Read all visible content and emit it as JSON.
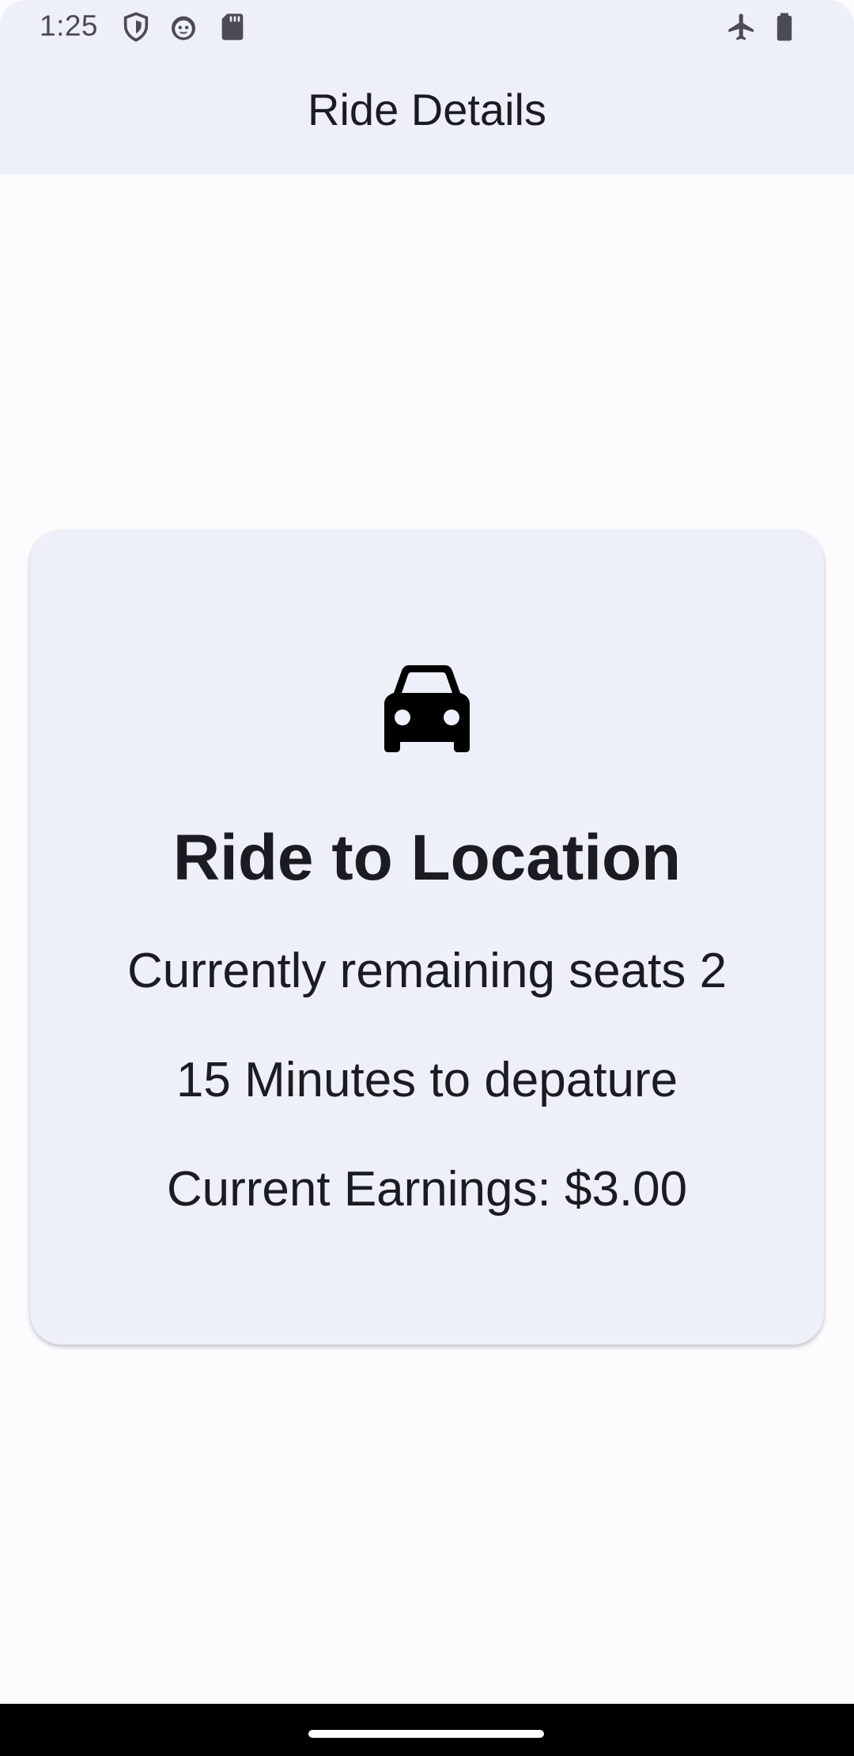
{
  "status_bar": {
    "time": "1:25",
    "icons": [
      "shield-icon",
      "cat-face-icon",
      "sd-card-icon",
      "airplane-mode-icon",
      "battery-icon"
    ]
  },
  "app_bar": {
    "title": "Ride Details"
  },
  "ride_card": {
    "icon": "car-icon",
    "title": "Ride to Location",
    "seats_text": "Currently remaining seats 2",
    "departure_text": "15 Minutes to depature",
    "earnings_text": "Current Earnings: $3.00"
  },
  "colors": {
    "app_bar_bg": "#edeff9",
    "page_bg": "#fdfbfe",
    "card_bg": "#edeff9",
    "text": "#1b1b21",
    "nav_bar_bg": "#000000"
  }
}
